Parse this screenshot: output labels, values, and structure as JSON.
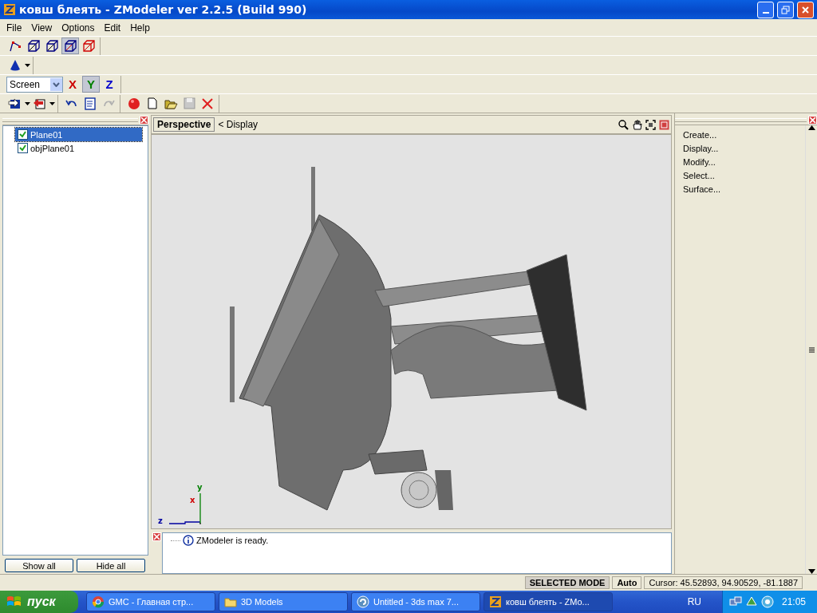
{
  "window": {
    "title": "ковш блеять - ZModeler ver 2.2.5 (Build 990)"
  },
  "menu": [
    "File",
    "View",
    "Options",
    "Edit",
    "Help"
  ],
  "selection_toolbar": [
    {
      "kind": "vertex",
      "pressed": false
    },
    {
      "kind": "edge",
      "pressed": false
    },
    {
      "kind": "face",
      "pressed": false
    },
    {
      "kind": "object",
      "pressed": true
    },
    {
      "kind": "group",
      "pressed": false
    }
  ],
  "axis_toolbar": {
    "coordinate_system": "Screen",
    "axes": [
      {
        "label": "X",
        "pressed": false,
        "color": "#cc0000"
      },
      {
        "label": "Y",
        "pressed": true,
        "color": "#008000"
      },
      {
        "label": "Z",
        "pressed": false,
        "color": "#0000cc"
      }
    ]
  },
  "tree": [
    {
      "label": "Plane01",
      "checked": true,
      "selected": true
    },
    {
      "label": "objPlane01",
      "checked": true,
      "selected": false
    }
  ],
  "left_buttons": [
    "Show all",
    "Hide all"
  ],
  "viewport": {
    "tabs": [
      {
        "label": "Perspective",
        "selected": true
      }
    ],
    "breadcrumb": "< Display",
    "axis_labels": [
      "y",
      "x",
      "z"
    ]
  },
  "log": [
    "ZModeler is ready."
  ],
  "commands": [
    "Create...",
    "Display...",
    "Modify...",
    "Select...",
    "Surface..."
  ],
  "status_bar": {
    "mode": "SELECTED MODE",
    "auto": "Auto",
    "cursor": "Cursor: 45.52893, 94.90529, -81.1887"
  },
  "taskbar": {
    "start": "пуск",
    "tasks": [
      {
        "label": "GMC - Главная стр...",
        "kind": "browser",
        "selected": false
      },
      {
        "label": "3D Models",
        "kind": "folder",
        "selected": false
      },
      {
        "label": "Untitled - 3ds max 7...",
        "kind": "max",
        "selected": false
      },
      {
        "label": "ковш блеять - ZMo...",
        "kind": "zmodeler",
        "selected": true
      }
    ],
    "language": "RU",
    "clock": "21:05"
  }
}
